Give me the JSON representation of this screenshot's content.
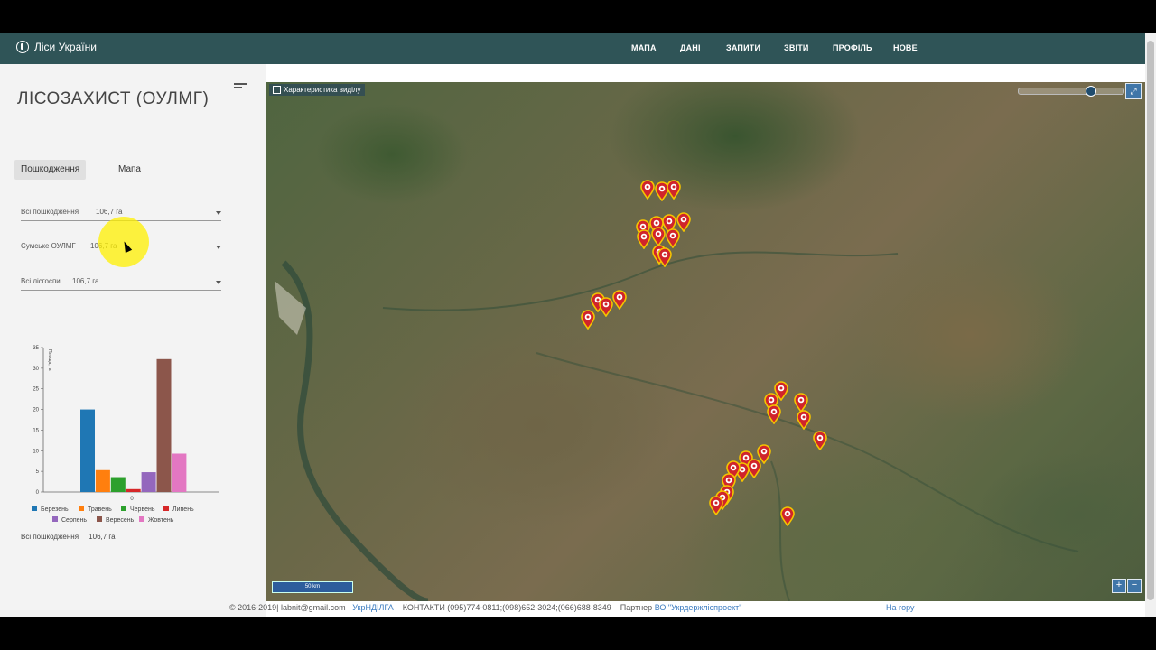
{
  "app": {
    "brand": "Ліси України"
  },
  "nav": {
    "items": [
      "МАПА",
      "ДАНІ",
      "ЗАПИТИ",
      "ЗВІТИ",
      "ПРОФІЛЬ",
      "НОВЕ"
    ]
  },
  "sidebar": {
    "title": "ЛІСОЗАХИСТ (ОУЛМГ)",
    "tabs": [
      {
        "label": "Пошкодження",
        "active": true
      },
      {
        "label": "Мапа",
        "active": false
      }
    ],
    "filters": [
      {
        "label": "Всі пошкодження",
        "value": "106,7 га"
      },
      {
        "label": "Сумське ОУЛМГ",
        "value": "106,7 га"
      },
      {
        "label": "Всі лісгоспи",
        "value": "106,7 га"
      }
    ],
    "summary": {
      "label": "Всі пошкодження",
      "value": "106,7 га"
    }
  },
  "chart_data": {
    "type": "bar",
    "ylabel": "Площа, га",
    "xlabel": "",
    "ylim": [
      0,
      35
    ],
    "yticks": [
      "0",
      "5",
      "10",
      "15",
      "20",
      "25",
      "30",
      "35"
    ],
    "xticks": [
      "0"
    ],
    "series": [
      {
        "name": "Березень",
        "value": 20,
        "color": "#1f77b4"
      },
      {
        "name": "Травень",
        "value": 5.3,
        "color": "#ff7f0e"
      },
      {
        "name": "Червень",
        "value": 3.6,
        "color": "#2ca02c"
      },
      {
        "name": "Липень",
        "value": 0.7,
        "color": "#d62728"
      },
      {
        "name": "Серпень",
        "value": 4.8,
        "color": "#9467bd"
      },
      {
        "name": "Вересень",
        "value": 32.2,
        "color": "#8c564b"
      },
      {
        "name": "Жовтень",
        "value": 9.3,
        "color": "#e377c2"
      }
    ],
    "grid": false,
    "legend": "bottom"
  },
  "map": {
    "layer_label": "Характеристика виділу",
    "scale_label": "50 km",
    "zoom_in": "+",
    "zoom_out": "−"
  },
  "footer": {
    "copyright": "© 2016-2019| labnit@gmail.com",
    "org": "УкрНДІЛГА",
    "contacts": "КОНТАКТИ (095)774-0811;(098)652-3024;(066)688-8349",
    "partner_label": "Партнер",
    "partner": "ВО \"Укрдержліспроект\"",
    "top_link": "На гору"
  },
  "colors": {
    "navbar": "#2f5457",
    "pin": "#d0242b",
    "pin_border": "#f5c400"
  }
}
